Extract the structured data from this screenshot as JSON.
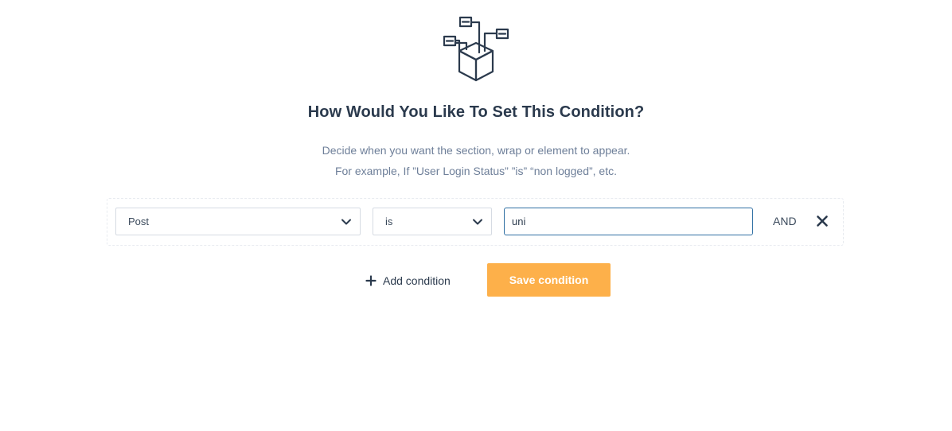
{
  "header": {
    "icon": "box-network-icon",
    "title": "How Would You Like To Set This Condition?",
    "description_line1": "Decide when you want the section, wrap or element to appear.",
    "description_line2": "For example, If ”User Login Status” ”is” “non logged”, etc."
  },
  "condition": {
    "field_select": {
      "value": "Post",
      "icon": "chevron-down-icon"
    },
    "operator_select": {
      "value": "is",
      "icon": "chevron-down-icon"
    },
    "value_input": {
      "value": "uni"
    },
    "logic_label": "AND",
    "remove_icon": "close-icon"
  },
  "actions": {
    "add_condition_label": "Add condition",
    "add_condition_icon": "plus-icon",
    "save_condition_label": "Save condition"
  },
  "colors": {
    "accent": "#fdb04a",
    "input_focus_border": "#2f6fa3",
    "heading": "#2b3a4d",
    "muted_text": "#6e7f99"
  }
}
